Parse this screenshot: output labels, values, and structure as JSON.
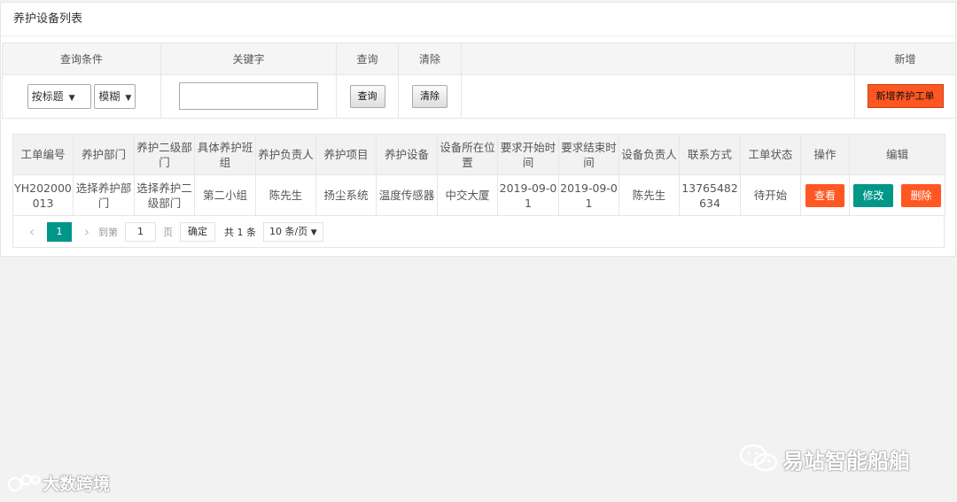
{
  "page": {
    "title": "养护设备列表"
  },
  "query": {
    "headers": [
      "查询条件",
      "关键字",
      "查询",
      "清除",
      "",
      "新增"
    ],
    "condition_select": "按标题",
    "match_select": "模糊",
    "keyword_value": "",
    "search_label": "查询",
    "clear_label": "清除",
    "add_label": "新增养护工单"
  },
  "table": {
    "headers": [
      "工单编号",
      "养护部门",
      "养护二级部门",
      "具体养护班组",
      "养护负责人",
      "养护项目",
      "养护设备",
      "设备所在位置",
      "要求开始时间",
      "要求结束时间",
      "设备负责人",
      "联系方式",
      "工单状态",
      "操作",
      "编辑"
    ],
    "rows": [
      {
        "cells": [
          "YH202000013",
          "选择养护部门",
          "选择养护二级部门",
          "第二小组",
          "陈先生",
          "扬尘系统",
          "温度传感器",
          "中交大厦",
          "2019-09-01",
          "2019-09-01",
          "陈先生",
          "13765482634",
          "待开始"
        ],
        "view_label": "查看",
        "edit_label": "修改",
        "delete_label": "删除"
      }
    ]
  },
  "pager": {
    "current_page": "1",
    "goto_prefix": "到第",
    "goto_value": "1",
    "goto_suffix": "页",
    "confirm_label": "确定",
    "total": "共 1 条",
    "page_size": "10 条/页"
  },
  "watermarks": {
    "left": "大数跨境",
    "right": "易站智能船舶"
  },
  "colors": {
    "accent_orange": "#ff5722",
    "accent_green": "#009688"
  }
}
